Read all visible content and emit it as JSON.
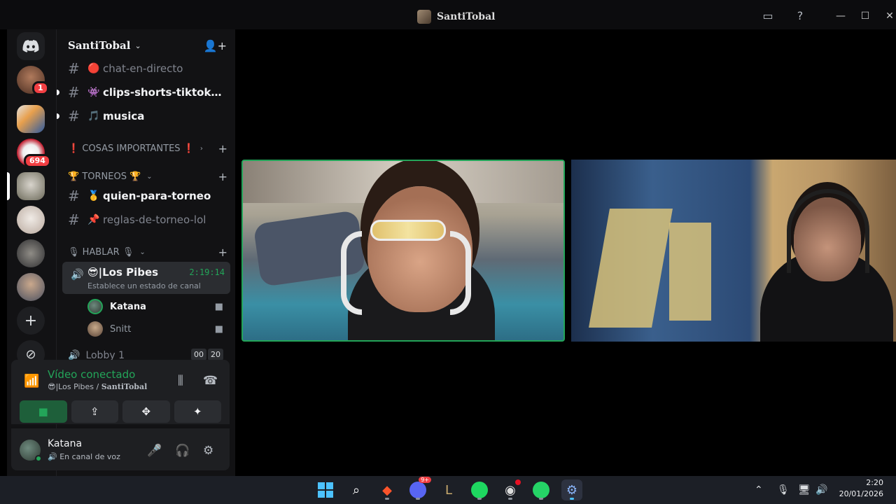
{
  "window": {
    "title": "SantiTobal"
  },
  "server": {
    "name": "SantiTobal",
    "badges": [
      "1",
      "694"
    ]
  },
  "channels": [
    {
      "emoji": "🔴",
      "name": "chat-en-directo",
      "bold": false
    },
    {
      "emoji": "👾",
      "name": "clips-shorts-tiktok-r...",
      "bold": true
    },
    {
      "emoji": "🎵",
      "name": "musica",
      "bold": true
    }
  ],
  "categories": {
    "important": "❗ COSAS IMPORTANTES ❗",
    "torneos": "🏆 TORNEOS 🏆",
    "hablar": "🎙 HABLAR 🎙"
  },
  "torneo_channels": [
    {
      "emoji": "🥇",
      "name": "quien-para-torneo",
      "bold": true
    },
    {
      "emoji": "📌",
      "name": "reglas-de-torneo-lol",
      "bold": false
    }
  ],
  "voice": {
    "channel": "😎|Los Pibes",
    "time": "2:19:14",
    "status": "Establece un estado de canal",
    "members": [
      "Katana",
      "Snitt"
    ],
    "lobby": "Lobby 1",
    "lobby_count": [
      "00",
      "20"
    ]
  },
  "rtc": {
    "title": "Vídeo conectado",
    "sub_channel": "😎|Los Pibes / ",
    "sub_server": "SantiTobal"
  },
  "user": {
    "name": "Katana",
    "status": "En canal de voz"
  },
  "taskbar": {
    "time": "2:20",
    "date": "20/01/2026",
    "discord_badge": "9+"
  },
  "colors": {
    "green": "#23a559",
    "accent_red": "#f23f43",
    "sidebar_bg": "#121214"
  }
}
